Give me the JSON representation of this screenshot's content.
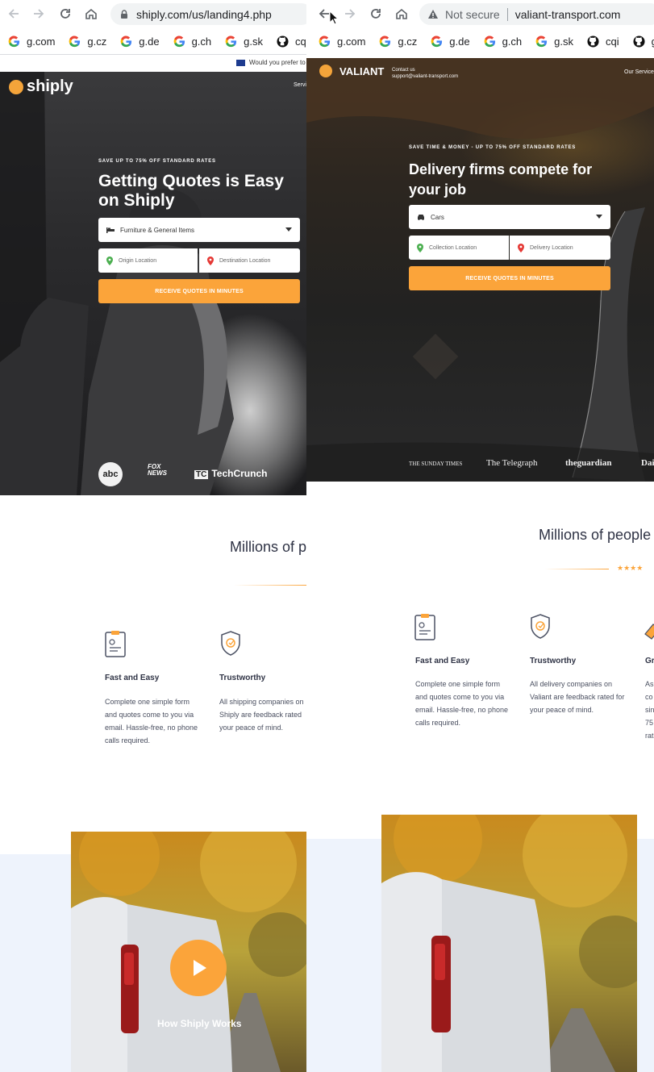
{
  "left": {
    "browser": {
      "url": "shiply.com/us/landing4.php",
      "bookmarks": [
        "g.com",
        "g.cz",
        "g.de",
        "g.ch",
        "g.sk",
        "cq"
      ]
    },
    "banner": {
      "text": "Would you prefer to"
    },
    "hero": {
      "logo": "shiply",
      "menu": "Servi",
      "kicker": "SAVE UP TO 75% OFF STANDARD RATES",
      "headline": "Getting Quotes is Easy on Shiply",
      "select_value": "Furniture & General Items",
      "origin_placeholder": "Origin Location",
      "destination_placeholder": "Destination Location",
      "cta": "RECEIVE QUOTES IN MINUTES",
      "press": [
        "abc",
        "FOX NEWS",
        "TechCrunch"
      ]
    },
    "section_title": "Millions of p",
    "features": [
      {
        "title": "Fast and Easy",
        "lines": [
          "Complete one simple form",
          "and quotes come to you via",
          "email. Hassle-free, no phone",
          "calls required."
        ]
      },
      {
        "title": "Trustworthy",
        "lines": [
          "All shipping companies on",
          "Shiply are feedback rated",
          "your peace of mind."
        ]
      }
    ],
    "video_label": "How Shiply Works"
  },
  "right": {
    "browser": {
      "not_secure": "Not secure",
      "url": "valiant-transport.com",
      "bookmarks": [
        "g.com",
        "g.cz",
        "g.de",
        "g.ch",
        "g.sk",
        "cqi",
        "g"
      ]
    },
    "hero": {
      "logo": "VALIANT",
      "contact_label": "Contact us",
      "contact_email": "support@valiant-transport.com",
      "menu": "Our Service",
      "kicker": "SAVE TIME & MONEY - UP TO 75% OFF STANDARD RATES",
      "headline": "Delivery firms compete for your job",
      "select_value": "Cars",
      "collection_placeholder": "Collection Location",
      "delivery_placeholder": "Delivery Location",
      "cta": "RECEIVE QUOTES IN MINUTES",
      "press": [
        "THE SUNDAY TIMES",
        "The Telegraph",
        "theguardian",
        "Dai"
      ]
    },
    "section_title": "Millions of people",
    "stars": "★★★★",
    "features": [
      {
        "title": "Fast and Easy",
        "lines": [
          "Complete one simple form",
          "and quotes come to you via",
          "email. Hassle-free, no phone",
          "calls required."
        ]
      },
      {
        "title": "Trustworthy",
        "lines": [
          "All delivery companies on",
          "Valiant are feedback rated for",
          "your peace of mind."
        ]
      },
      {
        "title": "Gr",
        "lines": [
          "As",
          "co",
          "sin",
          "75",
          "rat"
        ]
      }
    ]
  },
  "colors": {
    "accent": "#fba43a",
    "title": "#2f3345",
    "hero_left": "#2b2b2d",
    "hero_right": "#2c2620"
  }
}
